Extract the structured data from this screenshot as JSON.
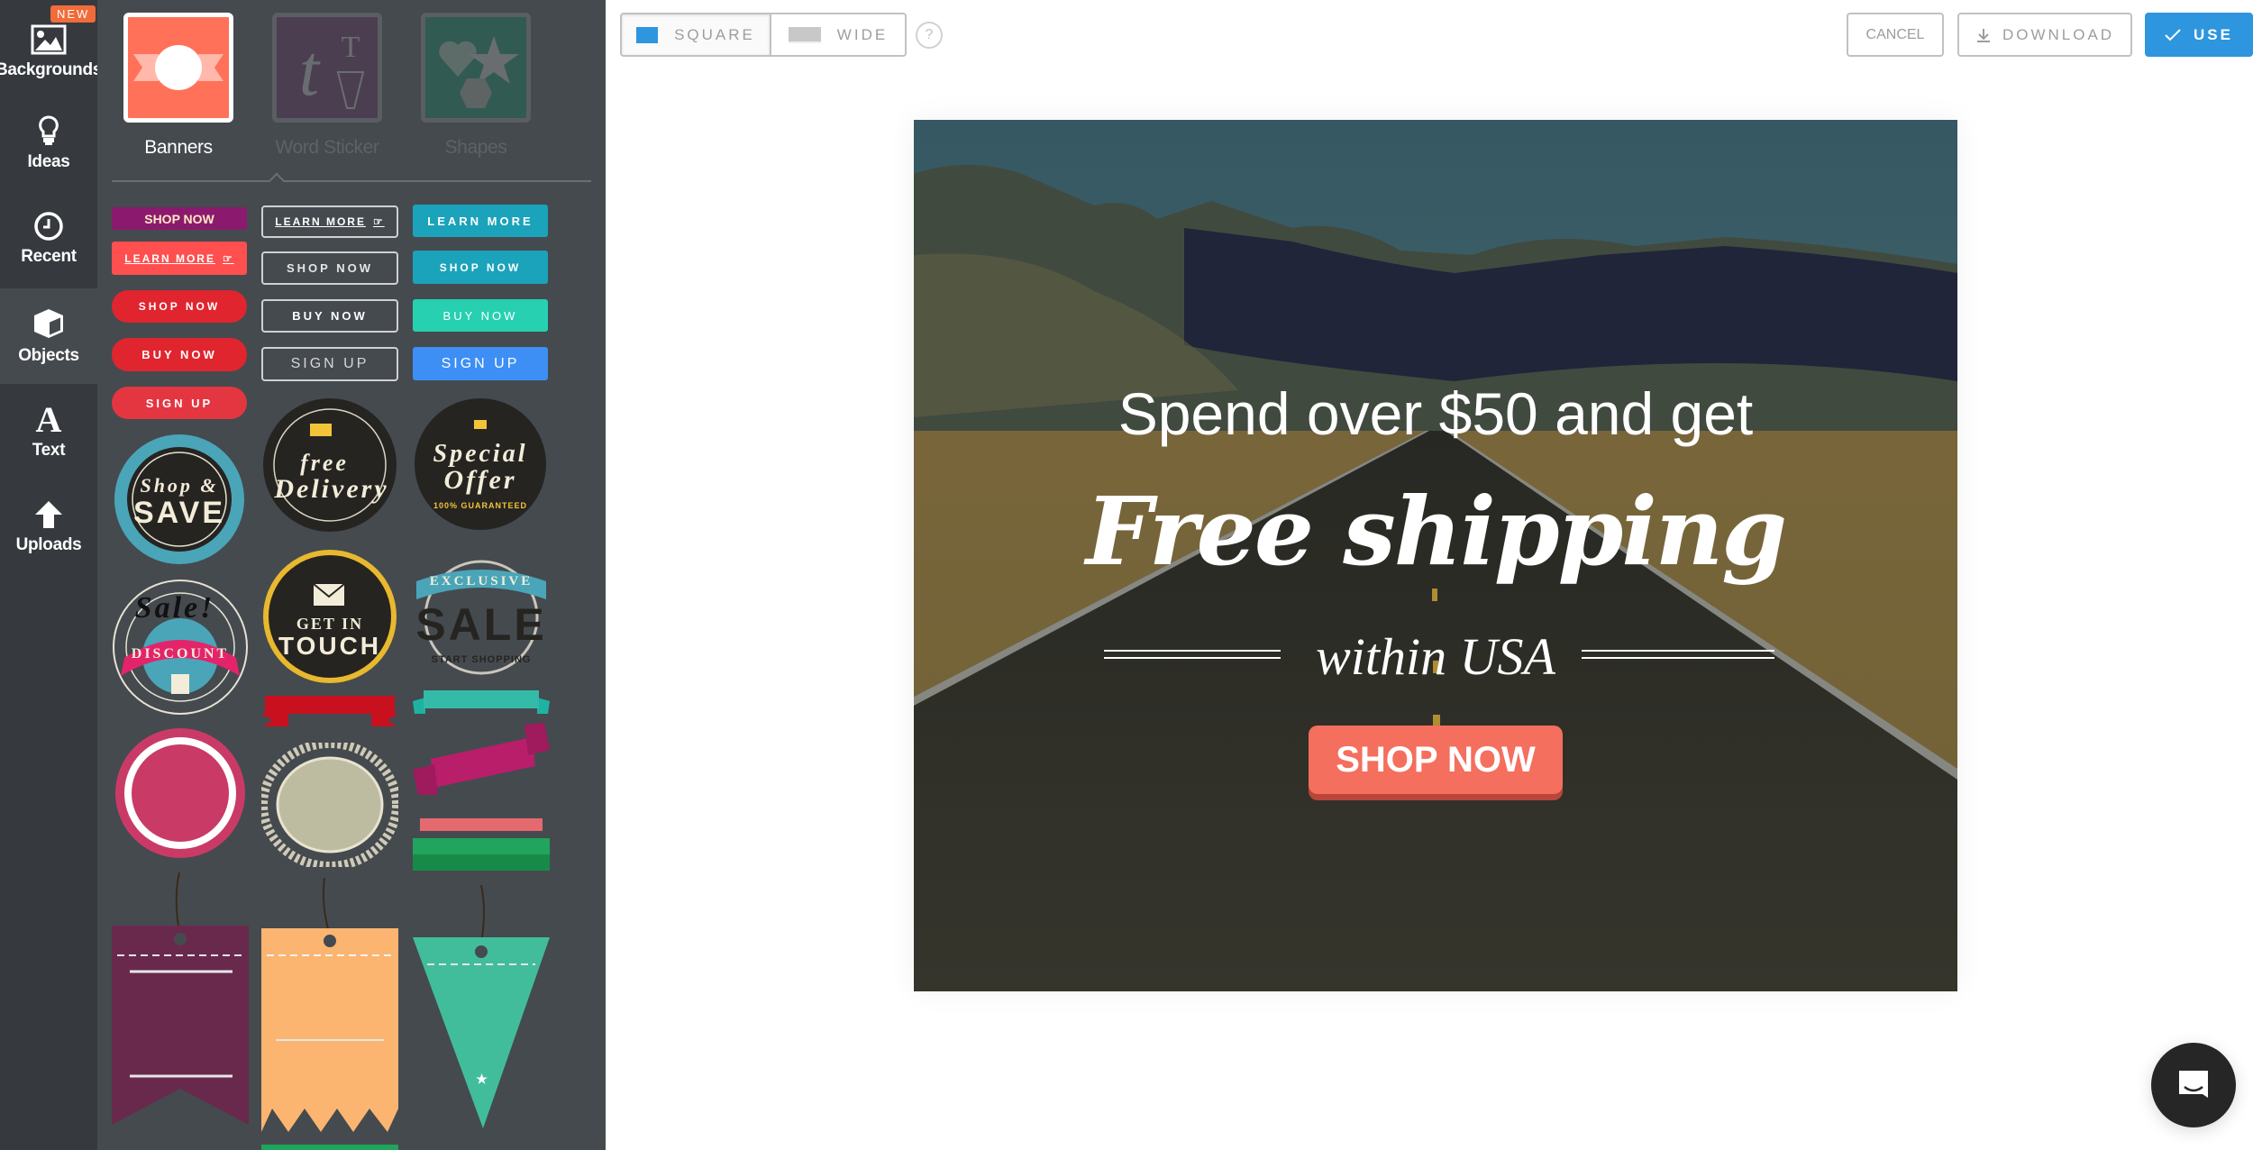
{
  "sidebar": {
    "new_badge": "NEW",
    "items": [
      {
        "label": "Backgrounds",
        "icon": "image-icon"
      },
      {
        "label": "Ideas",
        "icon": "lightbulb-icon"
      },
      {
        "label": "Recent",
        "icon": "clock-icon"
      },
      {
        "label": "Objects",
        "icon": "cube-icon",
        "active": true
      },
      {
        "label": "Text",
        "icon": "text-icon"
      },
      {
        "label": "Uploads",
        "icon": "upload-arrow-icon"
      }
    ]
  },
  "panel": {
    "categories": [
      {
        "label": "Banners",
        "active": true
      },
      {
        "label": "Word Sticker",
        "active": false
      },
      {
        "label": "Shapes",
        "active": false
      }
    ],
    "buttons_col1": [
      "SHOP NOW",
      "LEARN MORE",
      "SHOP NOW",
      "BUY NOW",
      "SIGN UP"
    ],
    "buttons_col2": [
      "LEARN MORE",
      "SHOP NOW",
      "BUY NOW",
      "SIGN UP"
    ],
    "buttons_col3": [
      "LEARN MORE",
      "SHOP NOW",
      "BUY NOW",
      "SIGN UP"
    ],
    "badges": {
      "shop_save": {
        "line1": "Shop &",
        "line2": "SAVE"
      },
      "free_delivery": {
        "line1": "free",
        "line2": "Delivery"
      },
      "special_offer": {
        "line1": "Special",
        "line2": "Offer",
        "ring": "100% GUARANTEED"
      },
      "sale_discount": {
        "script": "Sale!",
        "ribbon": "DISCOUNT"
      },
      "get_in_touch": {
        "line1": "GET IN",
        "line2": "TOUCH"
      },
      "exclusive_sale": {
        "ribbon": "EXCLUSIVE",
        "main": "SALE",
        "ring": "START SHOPPING"
      }
    }
  },
  "toolbar": {
    "square_label": "SQUARE",
    "wide_label": "WIDE",
    "help_label": "?",
    "cancel_label": "CANCEL",
    "download_label": "DOWNLOAD",
    "use_label": "USE"
  },
  "canvas": {
    "headline": "Spend over $50 and get",
    "title": "Free shipping",
    "subtitle": "within USA",
    "cta": "SHOP NOW"
  },
  "colors": {
    "accent": "#2d96de",
    "cta": "#f46f5e",
    "badge_new": "#f26b3a",
    "sidebar_bg": "#363a3f",
    "panel_bg": "#454a4f"
  }
}
